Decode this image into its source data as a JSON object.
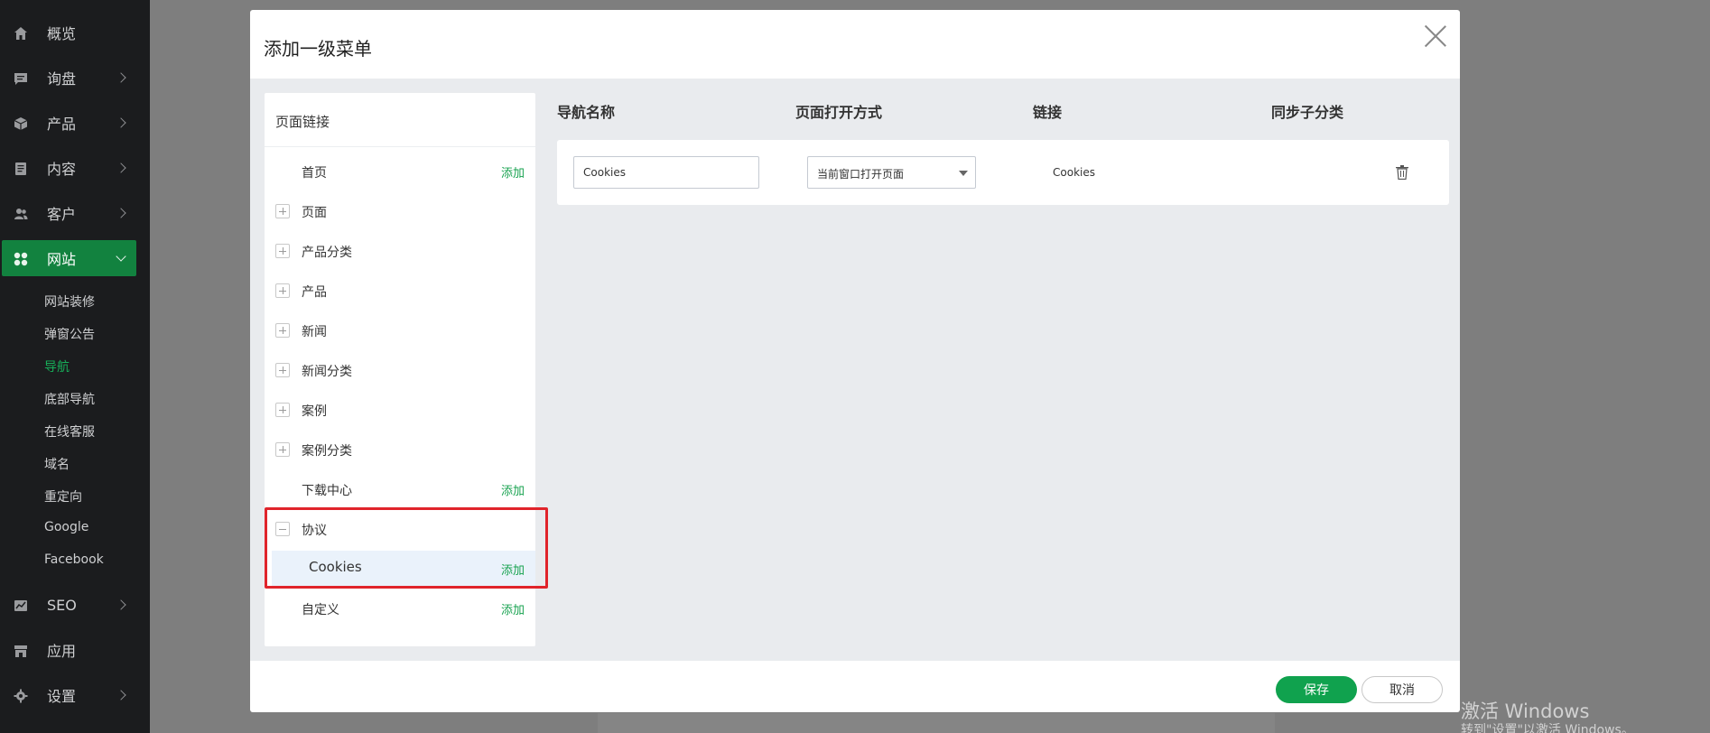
{
  "sidebar": {
    "items": [
      {
        "label": "概览",
        "icon": "home-icon",
        "chevron": false
      },
      {
        "label": "询盘",
        "icon": "message-icon",
        "chevron": true
      },
      {
        "label": "产品",
        "icon": "box-icon",
        "chevron": true
      },
      {
        "label": "内容",
        "icon": "document-icon",
        "chevron": true
      },
      {
        "label": "客户",
        "icon": "users-icon",
        "chevron": true
      },
      {
        "label": "网站",
        "icon": "grid-icon",
        "chevron": true,
        "active": true
      },
      {
        "label": "SEO",
        "icon": "chart-icon",
        "chevron": true
      },
      {
        "label": "应用",
        "icon": "store-icon",
        "chevron": false
      },
      {
        "label": "设置",
        "icon": "gear-icon",
        "chevron": true
      }
    ],
    "sub_items": [
      {
        "label": "网站装修"
      },
      {
        "label": "弹窗公告"
      },
      {
        "label": "导航",
        "active": true
      },
      {
        "label": "底部导航"
      },
      {
        "label": "在线客服"
      },
      {
        "label": "域名"
      },
      {
        "label": "重定向"
      },
      {
        "label": "Google"
      },
      {
        "label": "Facebook"
      }
    ]
  },
  "modal": {
    "title": "添加一级菜单",
    "left_panel": {
      "header": "页面链接",
      "add_label": "添加",
      "rows": [
        {
          "label": "首页",
          "toggle": "none",
          "add": true
        },
        {
          "label": "页面",
          "toggle": "plus",
          "add": false
        },
        {
          "label": "产品分类",
          "toggle": "plus",
          "add": false
        },
        {
          "label": "产品",
          "toggle": "plus",
          "add": false
        },
        {
          "label": "新闻",
          "toggle": "plus",
          "add": false
        },
        {
          "label": "新闻分类",
          "toggle": "plus",
          "add": false
        },
        {
          "label": "案例",
          "toggle": "plus",
          "add": false
        },
        {
          "label": "案例分类",
          "toggle": "plus",
          "add": false
        },
        {
          "label": "下载中心",
          "toggle": "none",
          "add": true
        },
        {
          "label": "协议",
          "toggle": "minus",
          "add": false
        },
        {
          "label": "Cookies",
          "toggle": "child",
          "add": true
        },
        {
          "label": "自定义",
          "toggle": "none",
          "add": true
        }
      ]
    },
    "table": {
      "headers": {
        "name": "导航名称",
        "open_mode": "页面打开方式",
        "link": "链接",
        "sync": "同步子分类"
      },
      "row": {
        "name": "Cookies",
        "open_mode": "当前窗口打开页面",
        "link": "Cookies"
      }
    },
    "footer": {
      "save": "保存",
      "cancel": "取消"
    }
  },
  "watermark": {
    "line1": "激活 Windows",
    "line2": "转到\"设置\"以激活 Windows。"
  },
  "colors": {
    "accent": "#10a24e",
    "sidebar_bg": "#1b1c1e",
    "highlight": "#e0242b"
  }
}
